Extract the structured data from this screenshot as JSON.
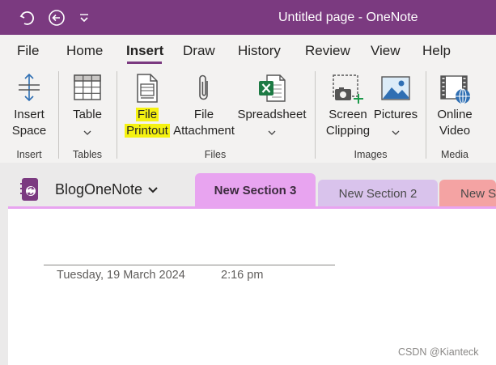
{
  "window": {
    "title": "Untitled page - OneNote"
  },
  "titlebar": {
    "icons": [
      "undo-icon",
      "back-icon",
      "quick-access-dropdown-icon"
    ]
  },
  "menu": {
    "tabs": [
      "File",
      "Home",
      "Insert",
      "Draw",
      "History",
      "Review",
      "View",
      "Help"
    ],
    "active": "Insert"
  },
  "ribbon": {
    "insert_space": {
      "line1": "Insert",
      "line2": "Space",
      "icon": "insert-space-icon"
    },
    "table": {
      "label": "Table",
      "icon": "table-icon"
    },
    "file_printout": {
      "line1": "File",
      "line2": "Printout",
      "icon": "file-printout-icon",
      "highlighted": true
    },
    "file_attachment": {
      "line1": "File",
      "line2": "Attachment",
      "icon": "paperclip-icon"
    },
    "spreadsheet": {
      "label": "Spreadsheet",
      "icon": "excel-icon"
    },
    "screen_clipping": {
      "line1": "Screen",
      "line2": "Clipping",
      "icon": "screen-clipping-icon"
    },
    "pictures": {
      "label": "Pictures",
      "icon": "pictures-icon"
    },
    "online_video": {
      "line1": "Online",
      "line2": "Video",
      "icon": "online-video-icon"
    },
    "groups": {
      "insert": "Insert",
      "tables": "Tables",
      "files": "Files",
      "images": "Images",
      "media": "Media"
    }
  },
  "notebook": {
    "name": "BlogOneNote",
    "icon": "notebook-icon"
  },
  "sections": [
    {
      "label": "New Section 3",
      "color": "#e8a4f0",
      "active": true
    },
    {
      "label": "New Section 2",
      "color": "#d9c3ec",
      "active": false
    },
    {
      "label": "New S",
      "color": "#f4a3a3",
      "active": false
    }
  ],
  "page": {
    "date": "Tuesday, 19 March 2024",
    "time": "2:16 pm"
  },
  "watermark": "CSDN @Kianteck",
  "colors": {
    "accent": "#7b3a80",
    "highlight": "#f5f211",
    "ribbon_bg": "#f3f2f1"
  }
}
